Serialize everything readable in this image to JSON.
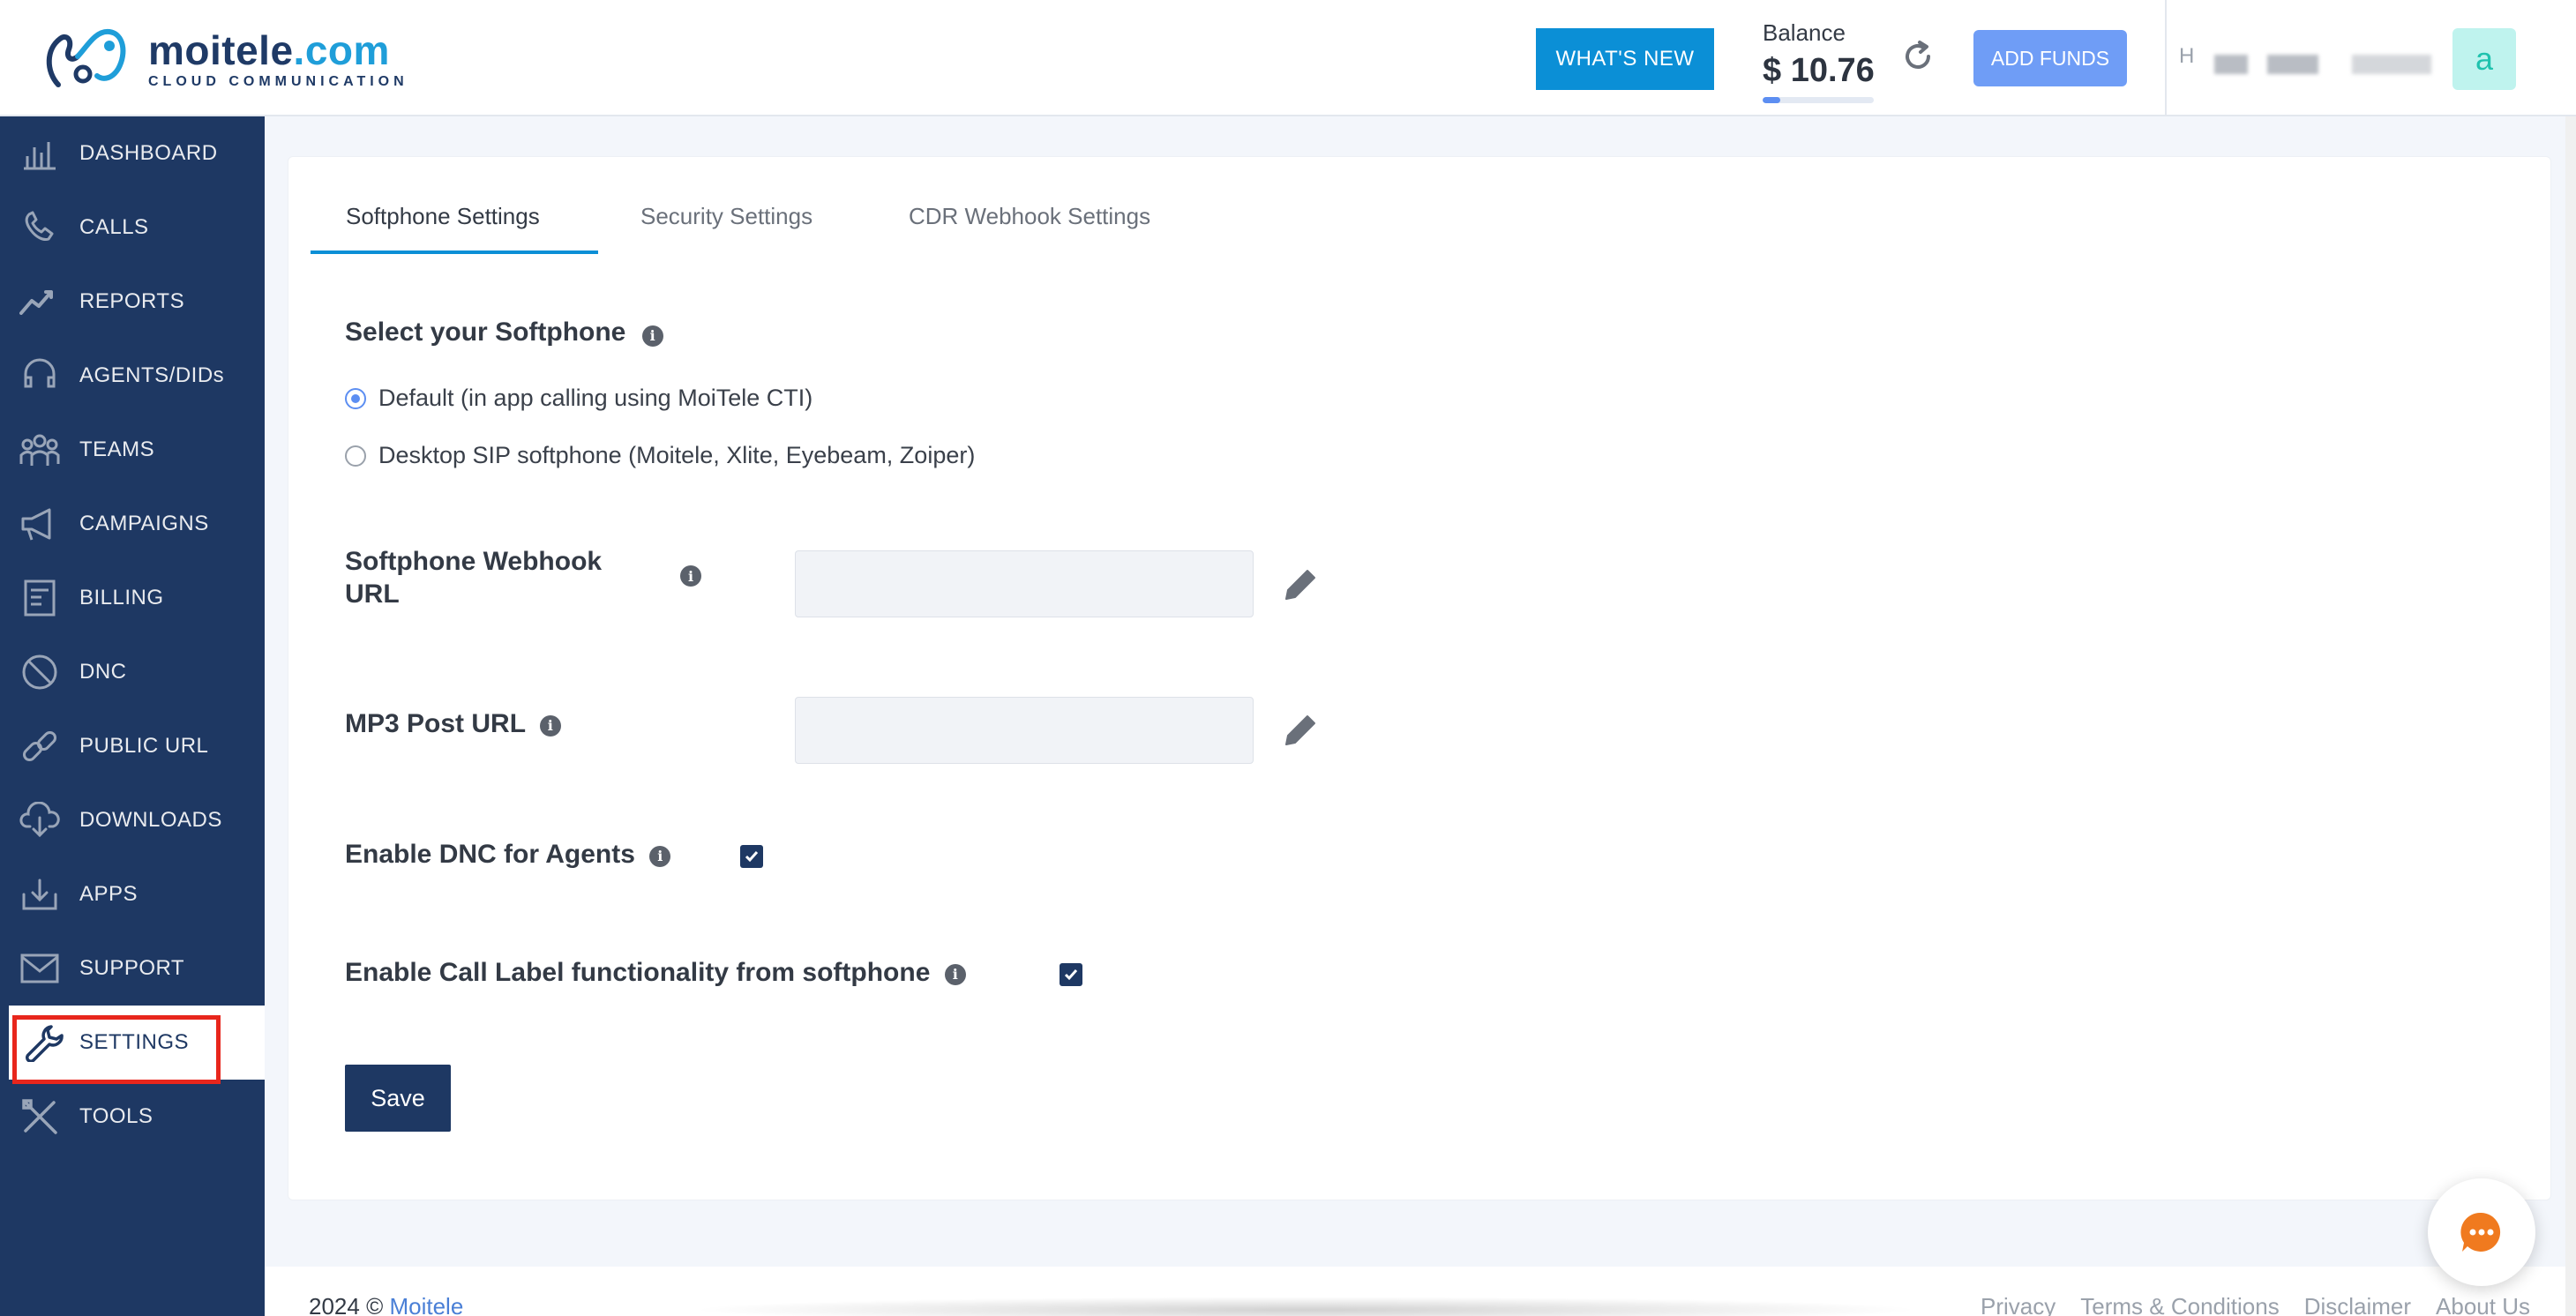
{
  "header": {
    "logo_main": "moitele",
    "logo_dot": ".com",
    "logo_sub": "CLOUD COMMUNICATION",
    "whats_new_label": "WHAT'S NEW",
    "balance_label": "Balance",
    "balance_amount": "$ 10.76",
    "add_funds_label": "ADD FUNDS",
    "user_initial_text": "H",
    "avatar_letter": "a"
  },
  "sidebar": {
    "items": [
      {
        "label": "DASHBOARD",
        "icon": "dashboard-icon"
      },
      {
        "label": "CALLS",
        "icon": "phone-icon"
      },
      {
        "label": "REPORTS",
        "icon": "chart-line-icon"
      },
      {
        "label": "AGENTS/DIDs",
        "icon": "headset-icon"
      },
      {
        "label": "TEAMS",
        "icon": "team-icon"
      },
      {
        "label": "CAMPAIGNS",
        "icon": "megaphone-icon"
      },
      {
        "label": "BILLING",
        "icon": "invoice-icon"
      },
      {
        "label": "DNC",
        "icon": "block-icon"
      },
      {
        "label": "PUBLIC URL",
        "icon": "link-icon"
      },
      {
        "label": "DOWNLOADS",
        "icon": "cloud-download-icon"
      },
      {
        "label": "APPS",
        "icon": "download-tray-icon"
      },
      {
        "label": "SUPPORT",
        "icon": "envelope-icon"
      },
      {
        "label": "SETTINGS",
        "icon": "wrench-icon"
      },
      {
        "label": "TOOLS",
        "icon": "tools-icon"
      }
    ],
    "active": "SETTINGS"
  },
  "tabs": [
    {
      "label": "Softphone Settings",
      "active": true
    },
    {
      "label": "Security Settings",
      "active": false
    },
    {
      "label": "CDR Webhook Settings",
      "active": false
    }
  ],
  "form": {
    "select_title": "Select your Softphone",
    "radio_default": "Default (in app calling using MoiTele CTI)",
    "radio_desktop": "Desktop SIP softphone (Moitele, Xlite, Eyebeam, Zoiper)",
    "webhook_label": "Softphone Webhook URL",
    "webhook_value": "",
    "mp3_label": "MP3 Post URL",
    "mp3_value": "",
    "dnc_label": "Enable DNC for Agents",
    "dnc_checked": true,
    "call_label_label": "Enable Call Label functionality from softphone",
    "call_label_checked": true,
    "save_label": "Save"
  },
  "footer": {
    "year": "2024 ©",
    "brand": "Moitele",
    "links": [
      "Privacy",
      "Terms & Conditions",
      "Disclaimer",
      "About Us"
    ]
  },
  "colors": {
    "sidebar_bg": "#1e3863",
    "primary_button": "#0b8fd6",
    "add_funds": "#6f9df6",
    "highlight": "#e8261c"
  }
}
